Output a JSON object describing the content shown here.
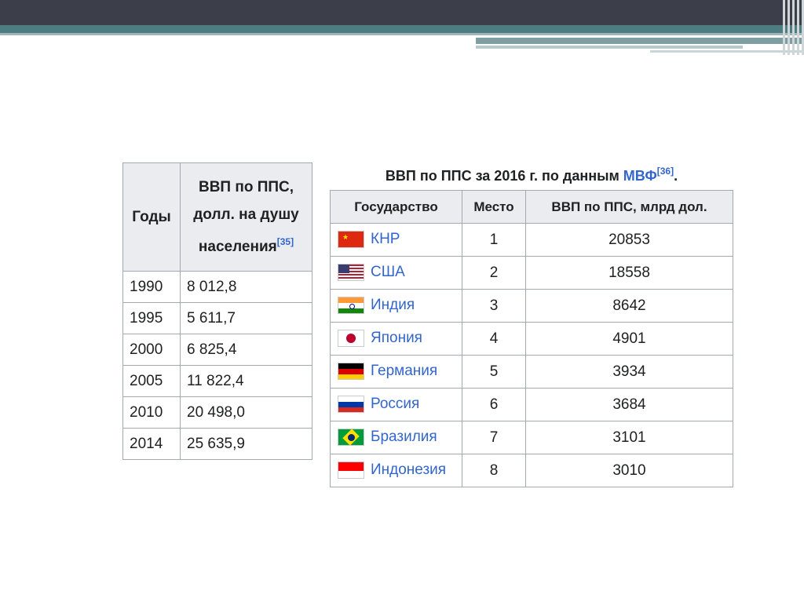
{
  "gdp_per_capita_table": {
    "header_years": "Годы",
    "header_value_lines": [
      "ВВП по ППС,",
      "долл. на душу",
      "населения"
    ],
    "header_ref": "[35]",
    "rows": [
      {
        "year": "1990",
        "value": "8 012,8"
      },
      {
        "year": "1995",
        "value": "5 611,7"
      },
      {
        "year": "2000",
        "value": "6 825,4"
      },
      {
        "year": "2005",
        "value": "11 822,4"
      },
      {
        "year": "2010",
        "value": "20 498,0"
      },
      {
        "year": "2014",
        "value": "25 635,9"
      }
    ]
  },
  "gdp_ranking_table": {
    "caption_text": "ВВП по ППС за 2016 г. по данным ",
    "caption_link": "МВФ",
    "caption_ref": "[36]",
    "caption_end": ".",
    "headers": {
      "state": "Государство",
      "rank": "Место",
      "gdp": "ВВП по ППС, млрд дол."
    },
    "rows": [
      {
        "flag": "china-flag-icon",
        "country": "КНР",
        "rank": "1",
        "gdp": "20853"
      },
      {
        "flag": "usa-flag-icon",
        "country": "США",
        "rank": "2",
        "gdp": "18558"
      },
      {
        "flag": "india-flag-icon",
        "country": "Индия",
        "rank": "3",
        "gdp": "8642"
      },
      {
        "flag": "japan-flag-icon",
        "country": "Япония",
        "rank": "4",
        "gdp": "4901"
      },
      {
        "flag": "germany-flag-icon",
        "country": "Германия",
        "rank": "5",
        "gdp": "3934"
      },
      {
        "flag": "russia-flag-icon",
        "country": "Россия",
        "rank": "6",
        "gdp": "3684"
      },
      {
        "flag": "brazil-flag-icon",
        "country": "Бразилия",
        "rank": "7",
        "gdp": "3101"
      },
      {
        "flag": "indonesia-flag-icon",
        "country": "Индонезия",
        "rank": "8",
        "gdp": "3010"
      }
    ]
  },
  "colors": {
    "link": "#3366cc",
    "header_bg": "#eaecf0",
    "border": "#a2a9b1",
    "slide_dark": "#3c3f4a",
    "slide_teal": "#4d7d80"
  }
}
